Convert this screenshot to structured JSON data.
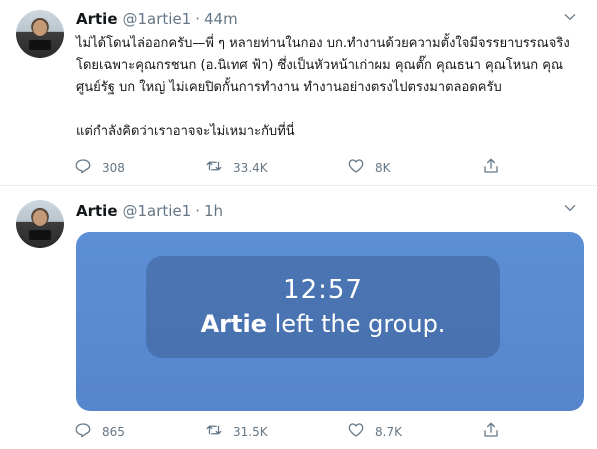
{
  "tweets": [
    {
      "name": "Artie",
      "handle": "@1artie1",
      "separator": "·",
      "time": "44m",
      "text": "ไม่ได้โดนไล่ออกครับ—พี่ ๆ หลายท่านในกอง บก.ทำงานด้วยความตั้งใจมีจรรยาบรรณจริง โดยเฉพาะคุณกรชนก (อ.นิเทศ ฟ้า) ซึ่งเป็นหัวหน้าเก่าผม คุณตั๊ก คุณธนา คุณโหนก คุณศูนย์รัฐ บก ใหญ่ ไม่เคยปิดกั้นการทำงาน ทำงานอย่างตรงไปตรงมาตลอดครับ\n\nแต่กำลังคิดว่าเราอาจจะไม่เหมาะกับที่นี่",
      "replies": "308",
      "retweets": "33.4K",
      "likes": "8K"
    },
    {
      "name": "Artie",
      "handle": "@1artie1",
      "separator": "·",
      "time": "1h",
      "media": {
        "time": "12:57",
        "actor": "Artie",
        "message": " left the group."
      },
      "replies": "865",
      "retweets": "31.5K",
      "likes": "8.7K"
    }
  ],
  "colors": {
    "secondary_text": "#657786",
    "divider": "#e6ecf0",
    "media_background": "#5a8ad2"
  },
  "icons": [
    "chevron-down-icon",
    "reply-icon",
    "retweet-icon",
    "like-icon",
    "share-icon"
  ]
}
